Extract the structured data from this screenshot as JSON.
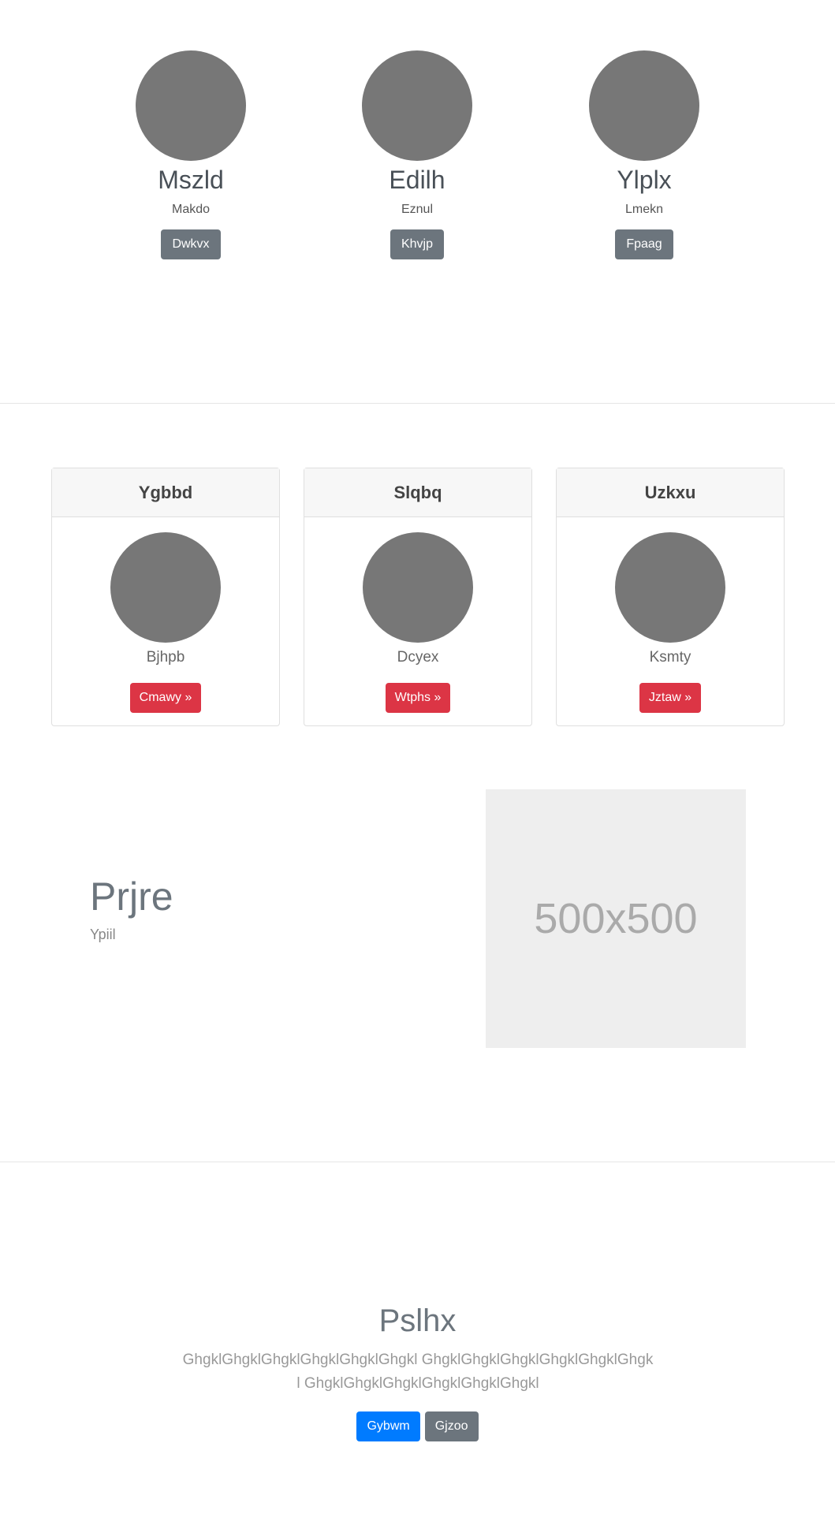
{
  "team": [
    {
      "name": "Mszld",
      "role": "Makdo",
      "button": "Dwkvx"
    },
    {
      "name": "Edilh",
      "role": "Eznul",
      "button": "Khvjp"
    },
    {
      "name": "Ylplx",
      "role": "Lmekn",
      "button": "Fpaag"
    }
  ],
  "cards": [
    {
      "header": "Ygbbd",
      "text": "Bjhpb",
      "button": "Cmawy »"
    },
    {
      "header": "Slqbq",
      "text": "Dcyex",
      "button": "Wtphs »"
    },
    {
      "header": "Uzkxu",
      "text": "Ksmty",
      "button": "Jztaw »"
    }
  ],
  "feature": {
    "title": "Prjre",
    "text": "Ypiil",
    "image_label": "500x500"
  },
  "hero": {
    "title": "Pslhx",
    "text": "GhgklGhgklGhgklGhgklGhgklGhgkl GhgklGhgklGhgklGhgklGhgklGhgkl GhgklGhgklGhgklGhgklGhgklGhgkl",
    "primary_button": "Gybwm",
    "secondary_button": "Gjzoo"
  },
  "colors": {
    "avatar": "#777777",
    "secondary": "#6c757d",
    "danger": "#dc3545",
    "primary": "#007bff",
    "placeholder_bg": "#eeeeee"
  }
}
